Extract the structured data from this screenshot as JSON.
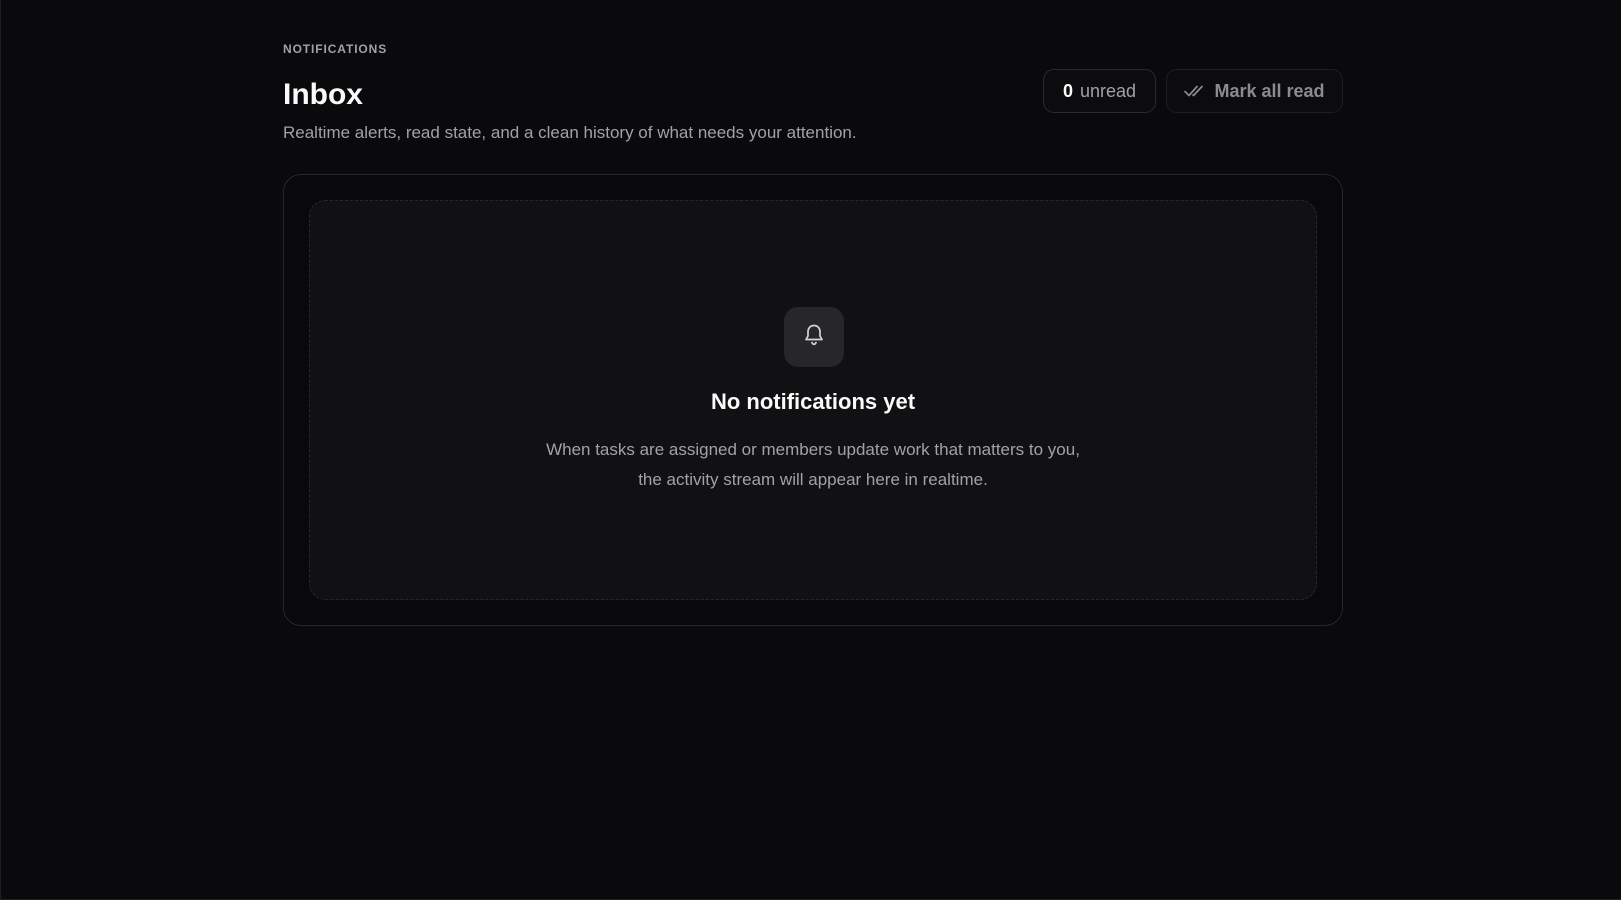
{
  "header": {
    "eyebrow": "NOTIFICATIONS",
    "title": "Inbox",
    "subtitle": "Realtime alerts, read state, and a clean history of what needs your attention."
  },
  "unread": {
    "count": "0",
    "label": "unread"
  },
  "actions": {
    "mark_all_read_label": "Mark all read",
    "mark_all_read_icon": "double-check-icon"
  },
  "empty_state": {
    "icon": "bell-icon",
    "title": "No notifications yet",
    "description_line1": "When tasks are assigned or members update work that matters to you,",
    "description_line2": "the activity stream will appear here in realtime."
  },
  "colors": {
    "background": "#0a0a0c",
    "card_border": "#27272a",
    "empty_surface": "#111113",
    "text_primary": "#fafafa",
    "text_muted": "#a1a1aa"
  }
}
